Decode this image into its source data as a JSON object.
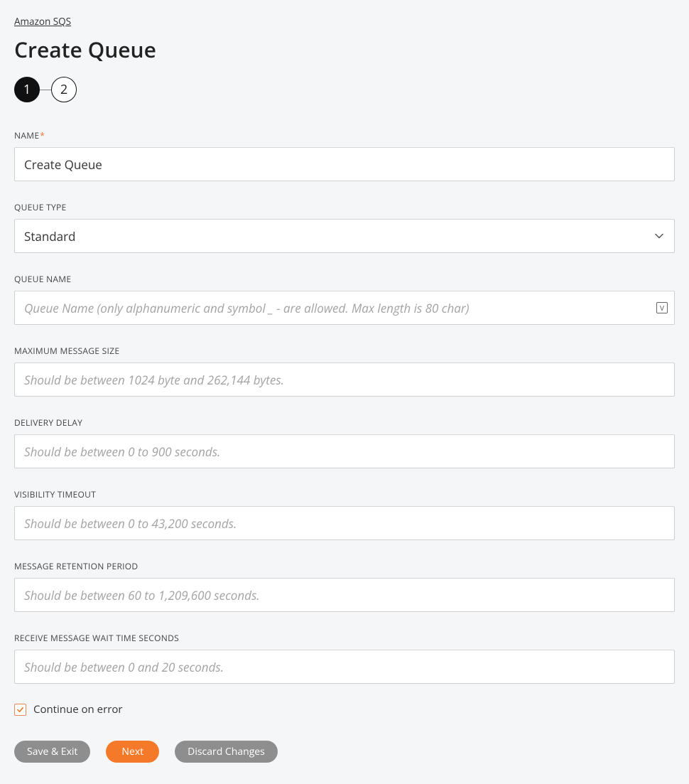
{
  "breadcrumb": {
    "label": "Amazon SQS"
  },
  "title": "Create Queue",
  "stepper": {
    "step1": "1",
    "step2": "2",
    "active": 1
  },
  "fields": {
    "name": {
      "label": "NAME",
      "required": true,
      "value": "Create Queue"
    },
    "queue_type": {
      "label": "QUEUE TYPE",
      "value": "Standard"
    },
    "queue_name": {
      "label": "QUEUE NAME",
      "placeholder": "Queue Name (only alphanumeric and symbol _ - are allowed. Max length is 80 char)",
      "badge": "V"
    },
    "max_msg_size": {
      "label": "MAXIMUM MESSAGE SIZE",
      "placeholder": "Should be between 1024 byte and 262,144 bytes."
    },
    "delivery_delay": {
      "label": "DELIVERY DELAY",
      "placeholder": "Should be between 0 to 900 seconds."
    },
    "visibility_timeout": {
      "label": "VISIBILITY TIMEOUT",
      "placeholder": "Should be between 0 to 43,200 seconds."
    },
    "retention": {
      "label": "MESSAGE RETENTION PERIOD",
      "placeholder": "Should be between 60 to 1,209,600 seconds."
    },
    "wait_time": {
      "label": "RECEIVE MESSAGE WAIT TIME SECONDS",
      "placeholder": "Should be between 0 and 20 seconds."
    }
  },
  "continue_on_error": {
    "label": "Continue on error",
    "checked": true
  },
  "actions": {
    "save_exit": "Save & Exit",
    "next": "Next",
    "discard": "Discard Changes"
  }
}
